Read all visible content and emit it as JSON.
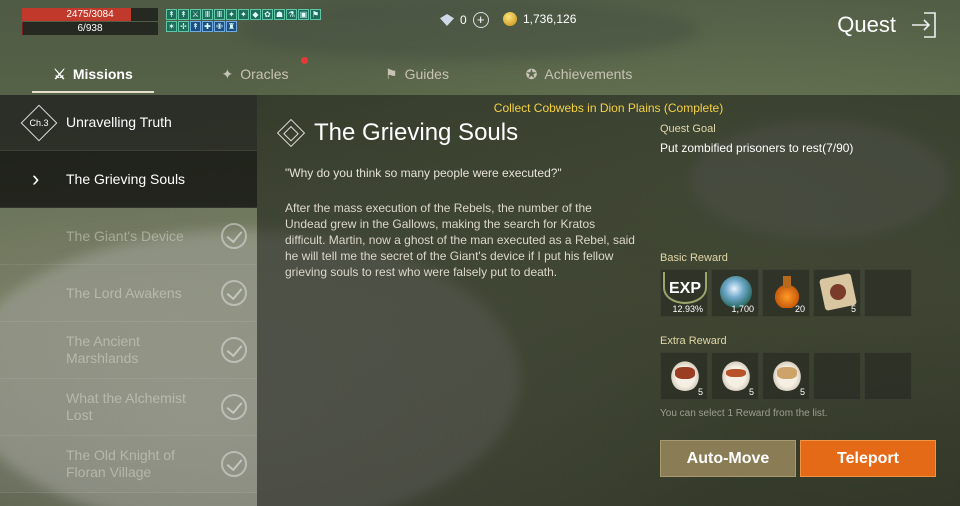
{
  "status": {
    "hp": {
      "text": "2475/3084",
      "fraction": 0.8025
    },
    "mp": {
      "text": "6/938",
      "fraction": 0.0064
    }
  },
  "buffs": [
    "↟",
    "↟",
    "⚔",
    "Ⅲ",
    "Ⅲ",
    "✦",
    "✦",
    "◆",
    "✿",
    "☗",
    "⚗",
    "▣",
    "⚑",
    "✶",
    "✢",
    "↟",
    "✚",
    "✙",
    "♜"
  ],
  "currency": {
    "gems": "0",
    "gold": "1,736,126"
  },
  "header": {
    "title": "Quest"
  },
  "tabs": [
    {
      "label": "Missions",
      "icon": "sword-icon",
      "active": true
    },
    {
      "label": "Oracles",
      "icon": "star-compass-icon",
      "active": false,
      "notification": true
    },
    {
      "label": "Guides",
      "icon": "flag-icon",
      "active": false
    },
    {
      "label": "Achievements",
      "icon": "medal-icon",
      "active": false
    }
  ],
  "quest_list": {
    "chapter": {
      "badge": "Ch.3",
      "label": "Unravelling Truth"
    },
    "current": {
      "label": "The Grieving Souls"
    },
    "completed": [
      "The Giant's Device",
      "The Lord Awakens",
      "The Ancient Marshlands",
      "What the Alchemist Lost",
      "The Old Knight of Floran Village"
    ]
  },
  "detail": {
    "notice": "Collect Cobwebs in Dion Plains (Complete)",
    "title": "The Grieving Souls",
    "quote": "\"Why do you think so many people were executed?\"",
    "description": "After the mass execution of the Rebels, the number of the Undead grew in the Gallows, making the search for Kratos difficult. Martin, now a ghost of the man executed as a Rebel, said he will tell me the secret of the Giant's device if I put his fellow grieving souls to rest who were falsely put to death.",
    "goal_label": "Quest Goal",
    "goal_text": "Put zombified prisoners to rest(7/90)",
    "basic_reward_label": "Basic Reward",
    "basic_rewards": [
      {
        "icon": "exp-icon",
        "label": "EXP",
        "qty": "12.93%"
      },
      {
        "icon": "silver-orb-icon",
        "qty": "1,700"
      },
      {
        "icon": "potion-icon",
        "qty": "20"
      },
      {
        "icon": "scroll-icon",
        "qty": "5"
      }
    ],
    "extra_reward_label": "Extra Reward",
    "extra_rewards": [
      {
        "icon": "steak-dish-icon",
        "qty": "5"
      },
      {
        "icon": "skewer-dish-icon",
        "qty": "5"
      },
      {
        "icon": "stew-dish-icon",
        "qty": "5"
      }
    ],
    "select_note": "You can select 1 Reward from the list.",
    "auto_move_label": "Auto-Move",
    "teleport_label": "Teleport"
  },
  "colors": {
    "accent_orange": "#e56a17",
    "notice_yellow": "#f5d142",
    "hp_red": "#c0392b"
  }
}
